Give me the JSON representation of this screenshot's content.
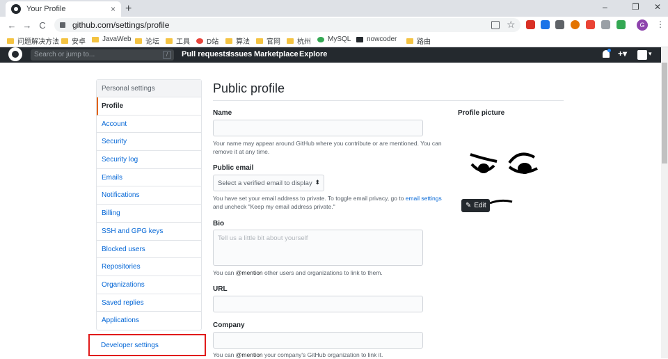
{
  "browser": {
    "tab_title": "Your Profile",
    "tab_close": "×",
    "new_tab": "+",
    "window_controls": [
      "–",
      "❐",
      "✕"
    ],
    "nav": [
      "←",
      "→",
      "C"
    ],
    "url": "github.com/settings/profile",
    "bookmarks": [
      "问题解决方法",
      "安卓",
      "JavaWeb",
      "论坛",
      "工具",
      "D站",
      "算法",
      "官网",
      "杭州",
      "MySQL",
      "nowcoder",
      "路由"
    ],
    "extension_colors": [
      "#d93025",
      "#1a73e8",
      "#5f6368",
      "#e37400",
      "#ea4335",
      "#9aa0a6",
      "#34a853"
    ],
    "profile_initial": "G"
  },
  "github_header": {
    "search_placeholder": "Search or jump to...",
    "search_key": "/",
    "nav": [
      "Pull requests",
      "Issues",
      "Marketplace",
      "Explore"
    ],
    "bell_icon": "bell-icon",
    "plus_label": "+▾",
    "avatar_menu": "▾"
  },
  "sidebar": {
    "heading": "Personal settings",
    "items": [
      "Profile",
      "Account",
      "Security",
      "Security log",
      "Emails",
      "Notifications",
      "Billing",
      "SSH and GPG keys",
      "Blocked users",
      "Repositories",
      "Organizations",
      "Saved replies",
      "Applications"
    ],
    "active_index": 0,
    "developer_settings": "Developer settings",
    "highlight_color": "#e11a1a"
  },
  "main": {
    "title": "Public profile",
    "name": {
      "label": "Name",
      "value": "",
      "note": "Your name may appear around GitHub where you contribute or are mentioned. You can remove it at any time."
    },
    "public_email": {
      "label": "Public email",
      "selected": "Select a verified email to display",
      "note_before": "You have set your email address to private. To toggle email privacy, go to ",
      "note_link": "email settings",
      "note_after": " and uncheck \"Keep my email address private.\""
    },
    "bio": {
      "label": "Bio",
      "placeholder": "Tell us a little bit about yourself",
      "note_prefix": "You can ",
      "note_mention": "@mention",
      "note_suffix": " other users and organizations to link to them."
    },
    "url": {
      "label": "URL",
      "value": ""
    },
    "company": {
      "label": "Company",
      "value": "",
      "note_prefix": "You can ",
      "note_mention": "@mention",
      "note_suffix": " your company's GitHub organization to link it."
    }
  },
  "profile_picture": {
    "label": "Profile picture",
    "edit_label": "Edit",
    "edit_icon": "pencil-icon"
  }
}
